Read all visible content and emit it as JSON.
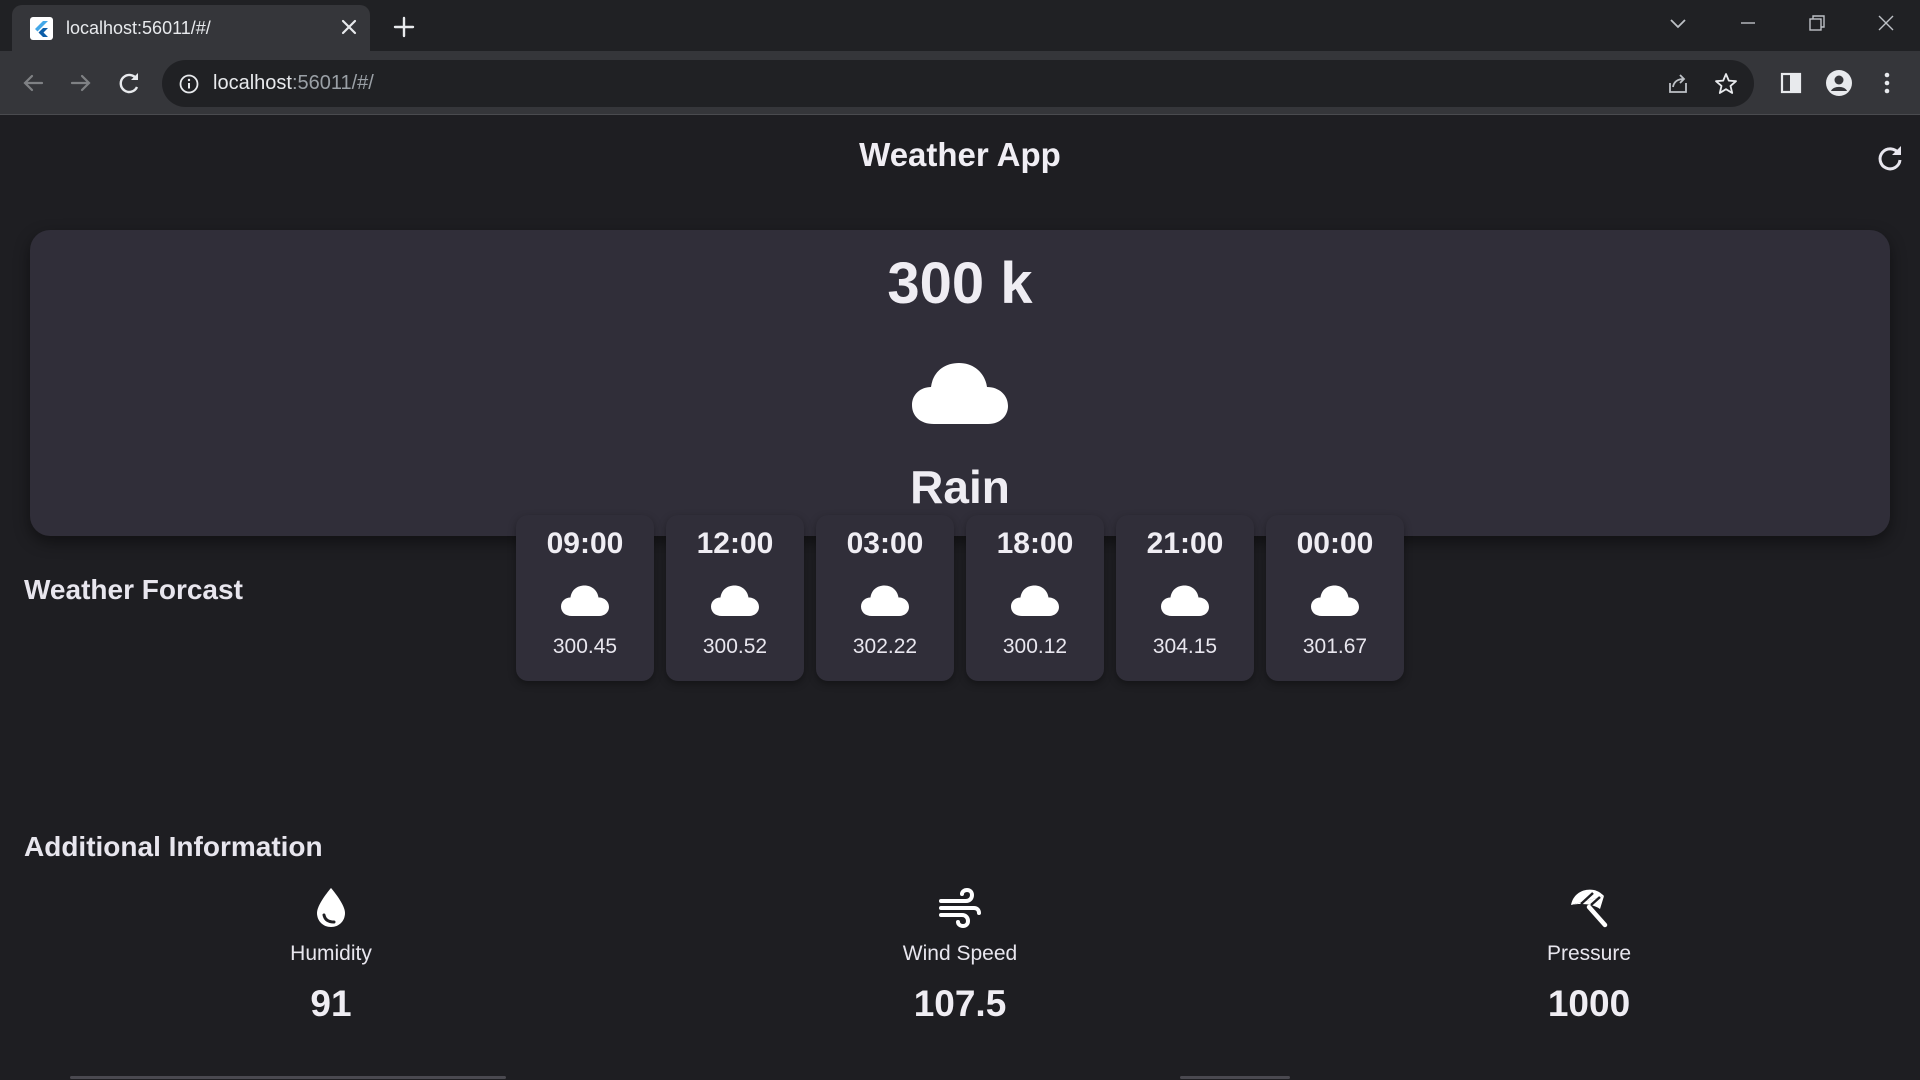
{
  "browser": {
    "tab_title": "localhost:56011/#/",
    "url_host": "localhost",
    "url_path": ":56011/#/"
  },
  "app": {
    "title": "Weather App",
    "current": {
      "temperature": "300 k",
      "condition": "Rain",
      "icon": "cloud-icon"
    },
    "forecast_title": "Weather Forcast",
    "forecast": [
      {
        "time": "09:00",
        "temp": "300.45",
        "icon": "cloud-icon"
      },
      {
        "time": "12:00",
        "temp": "300.52",
        "icon": "cloud-icon"
      },
      {
        "time": "03:00",
        "temp": "302.22",
        "icon": "cloud-icon"
      },
      {
        "time": "18:00",
        "temp": "300.12",
        "icon": "cloud-icon"
      },
      {
        "time": "21:00",
        "temp": "304.15",
        "icon": "cloud-icon"
      },
      {
        "time": "00:00",
        "temp": "301.67",
        "icon": "cloud-icon"
      }
    ],
    "additional_title": "Additional Information",
    "additional": [
      {
        "label": "Humidity",
        "value": "91",
        "icon": "water-drop-icon"
      },
      {
        "label": "Wind Speed",
        "value": "107.5",
        "icon": "wind-icon"
      },
      {
        "label": "Pressure",
        "value": "1000",
        "icon": "umbrella-icon"
      }
    ]
  },
  "colors": {
    "background": "#1e1e22",
    "card": "#302e39",
    "text": "#efedf3"
  }
}
